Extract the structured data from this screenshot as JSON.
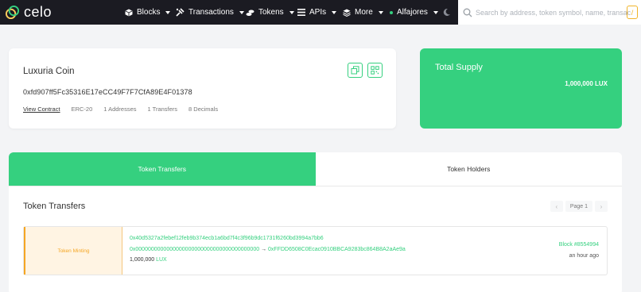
{
  "brand": {
    "name": "celo"
  },
  "nav": {
    "blocks": "Blocks",
    "transactions": "Transactions",
    "tokens": "Tokens",
    "apis": "APIs",
    "more": "More",
    "network": "Alfajores"
  },
  "search": {
    "placeholder": "Search by address, token symbol, name, transaction hash, or block number",
    "shortcut": "/"
  },
  "token": {
    "name": "Luxuria Coin",
    "address": "0xfd907ff5Fc35316E17eCC49F7F7CfA89E4F01378",
    "view_contract": "View Contract",
    "standard": "ERC-20",
    "addresses": "1 Addresses",
    "transfers": "1 Transfers",
    "decimals": "8 Decimals"
  },
  "supply": {
    "title": "Total Supply",
    "value": "1,000,000 LUX"
  },
  "tabs": {
    "transfers": "Token Transfers",
    "holders": "Token Holders"
  },
  "section": {
    "title": "Token Transfers",
    "page": "Page 1"
  },
  "transfer": {
    "type": "Token Minting",
    "hash": "0x40d5327a2febef12feb9b374ecb1a6bd7f4c3f96b9dc1731f6260bd3994a7bb6",
    "from": "0x0000000000000000000000000000000000000000",
    "arrow": "→",
    "to": "0xFFDD6508C0Ecac0910BBCA9283bc864B8A2aAe9a",
    "amount": "1,000,000",
    "unit": "LUX",
    "block": "Block #8554994",
    "time": "an hour ago"
  },
  "colors": {
    "accent": "#35d07f",
    "nav_bg": "#1b1b22",
    "minting": "#f5a623"
  },
  "icons": [
    "cube-icon",
    "transactions-icon",
    "tokens-icon",
    "apis-icon",
    "stack-icon",
    "moon-icon",
    "search-icon",
    "copy-icon",
    "qr-code-icon",
    "chevron-left-icon",
    "chevron-right-icon"
  ]
}
